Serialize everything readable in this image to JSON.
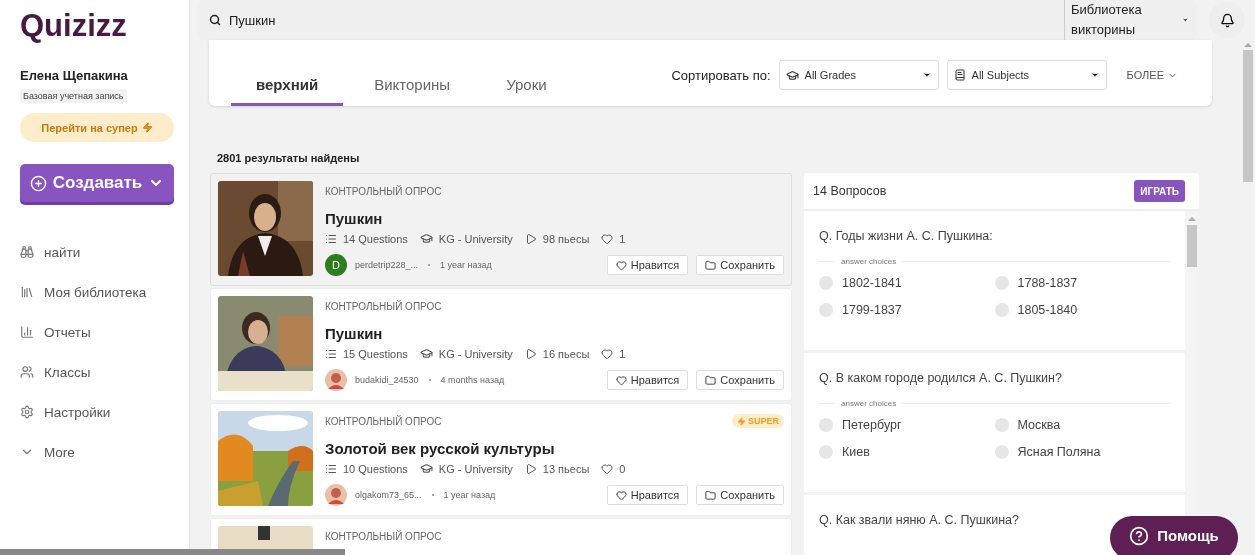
{
  "logo": "Quizizz",
  "user": {
    "name": "Елена Щепакина",
    "plan": "Базовая учетная запись",
    "upgrade": "Перейти на супер"
  },
  "create_button": "Создавать",
  "nav": [
    {
      "label": "найти"
    },
    {
      "label": "Моя библиотека"
    },
    {
      "label": "Отчеты"
    },
    {
      "label": "Классы"
    },
    {
      "label": "Настройки"
    },
    {
      "label": "More"
    }
  ],
  "search": {
    "value": "Пушкин",
    "scope": "Библиотека викторины"
  },
  "tabs": [
    {
      "label": "верхний",
      "selected": true
    },
    {
      "label": "Викторины",
      "selected": false
    },
    {
      "label": "Уроки",
      "selected": false
    }
  ],
  "filters": {
    "sort_label": "Сортировать по:",
    "grades": "All Grades",
    "subjects": "All Subjects",
    "more": "БОЛЕЕ"
  },
  "results_count": "2801 результаты найдены",
  "results": [
    {
      "type": "КОНТРОЛЬНЫЙ ОПРОС",
      "title": "Пушкин",
      "questions": "14",
      "questions_label": "Questions",
      "grades": "KG - University",
      "plays": "98 пьесы",
      "likes": "1",
      "author": "perdetrip228_...",
      "avatar": {
        "kind": "letter",
        "letter": "D"
      },
      "time": "1 year назад",
      "like_button": "Нравится",
      "save_button": "Сохранить",
      "selected": true
    },
    {
      "type": "КОНТРОЛЬНЫЙ ОПРОС",
      "title": "Пушкин",
      "questions": "15",
      "questions_label": "Questions",
      "grades": "KG - University",
      "plays": "16 пьесы",
      "likes": "1",
      "author": "budakidi_24530",
      "time": "4 months назад",
      "like_button": "Нравится",
      "save_button": "Сохранить",
      "selected": false
    },
    {
      "type": "КОНТРОЛЬНЫЙ ОПРОС",
      "title": "Золотой век русской культуры",
      "questions": "10",
      "questions_label": "Questions",
      "grades": "KG - University",
      "plays": "13 пьесы",
      "likes": "0",
      "author": "olgakom73_65...",
      "time": "1 year назад",
      "like_button": "Нравится",
      "save_button": "Сохранить",
      "selected": false,
      "badge": "SUPER"
    },
    {
      "type": "КОНТРОЛЬНЫЙ ОПРОС",
      "selected": false
    }
  ],
  "preview": {
    "count": "14 Вопросов",
    "play_button": "ИГРАТЬ",
    "questions": [
      {
        "text": "Q. Годы жизни А. С. Пушкина:",
        "choices_label": "answer choices",
        "choices": [
          {
            "text": "1802-1841",
            "selected": false
          },
          {
            "text": "1788-1837",
            "selected": false
          },
          {
            "text": "1799-1837",
            "selected": false
          },
          {
            "text": "1805-1840",
            "selected": false
          }
        ]
      },
      {
        "text": "Q. В каком городе родился А. С. Пушкин?",
        "choices_label": "answer choices",
        "choices": [
          {
            "text": "Петербург",
            "selected": false
          },
          {
            "text": "Москва",
            "selected": false
          },
          {
            "text": "Киев",
            "selected": false
          },
          {
            "text": "Ясная Поляна",
            "selected": false
          }
        ]
      },
      {
        "text": "Q. Как звали няню А. С. Пушкина?"
      }
    ]
  },
  "help_button": "Помощь"
}
